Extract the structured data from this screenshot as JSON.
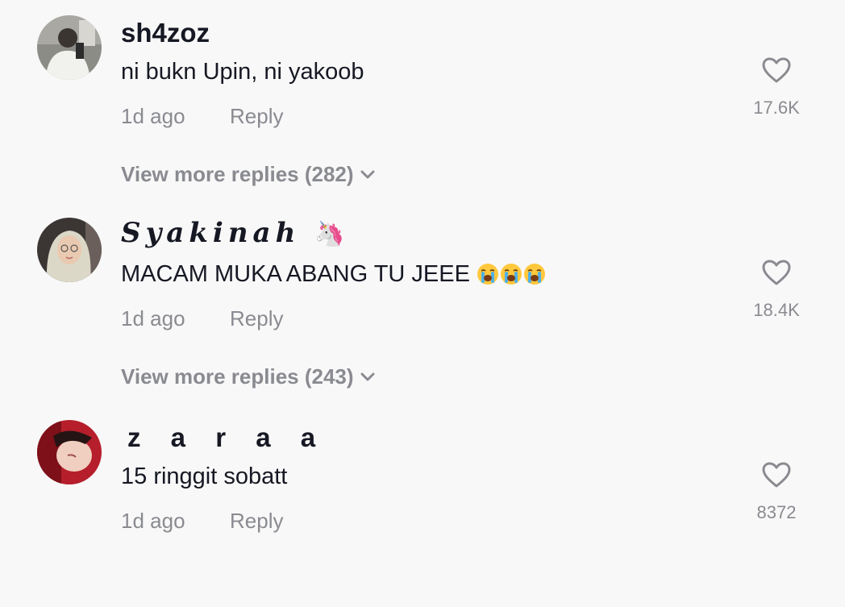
{
  "comments": [
    {
      "username": "sh4zoz",
      "text": "ni bukn Upin, ni yakoob",
      "time": "1d ago",
      "reply_label": "Reply",
      "likes": "17.6K",
      "more_replies": "View more replies (282)"
    },
    {
      "username": "𝑺𝒚𝒂𝒌𝒊𝒏𝒂𝒉",
      "username_emoji": "🦄",
      "text": "MACAM MUKA ABANG TU JEEE",
      "text_emoji": "😭😭😭",
      "time": "1d ago",
      "reply_label": "Reply",
      "likes": "18.4K",
      "more_replies": "View more replies (243)"
    },
    {
      "username": "z a r a a",
      "text": "15 ringgit sobatt",
      "time": "1d ago",
      "reply_label": "Reply",
      "likes": "8372"
    }
  ],
  "icons": {
    "like": "heart-outline-icon",
    "expand": "chevron-down-icon",
    "emoji": "loudly-crying-face"
  },
  "colors": {
    "background": "#f8f8f8",
    "primary_text": "#161823",
    "secondary_text": "#8a8b91"
  }
}
